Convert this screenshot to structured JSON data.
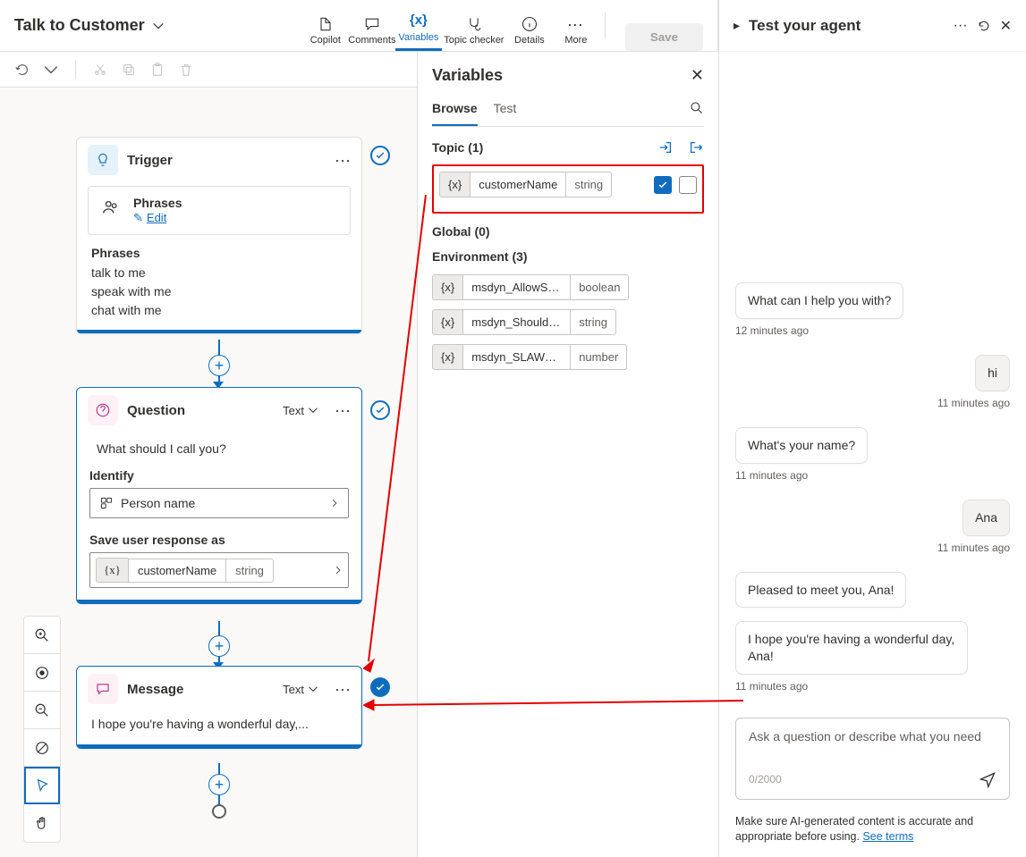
{
  "header": {
    "topic_title": "Talk to Customer",
    "tabs": {
      "copilot": "Copilot",
      "comments": "Comments",
      "variables": "Variables",
      "topic_checker": "Topic checker",
      "details": "Details",
      "more": "More"
    },
    "save_label": "Save"
  },
  "canvas": {
    "trigger": {
      "title": "Trigger",
      "phrases_label": "Phrases",
      "edit": "Edit",
      "subtitle": "Phrases",
      "lines": [
        "talk to me",
        "speak with me",
        "chat with me"
      ]
    },
    "question": {
      "title": "Question",
      "type": "Text",
      "prompt": "What should I call you?",
      "identify_label": "Identify",
      "identify_value": "Person name",
      "save_label": "Save user response as",
      "var_name": "customerName",
      "var_type": "string"
    },
    "message": {
      "title": "Message",
      "type": "Text",
      "text": "I hope you're having a wonderful day,..."
    }
  },
  "variables_panel": {
    "title": "Variables",
    "tabs": {
      "browse": "Browse",
      "test": "Test"
    },
    "topic_header": "Topic (1)",
    "topic_var": {
      "name": "customerName",
      "type": "string",
      "checked": true,
      "checked2": false
    },
    "global_header": "Global (0)",
    "env_header": "Environment (3)",
    "env_vars": [
      {
        "name": "msdyn_AllowSe…",
        "type": "boolean"
      },
      {
        "name": "msdyn_ShouldSho…",
        "type": "string"
      },
      {
        "name": "msdyn_SLAWeb…",
        "type": "number"
      }
    ]
  },
  "test_panel": {
    "title": "Test your agent",
    "messages": [
      {
        "who": "bot",
        "text": "What can I help you with?",
        "ts": "12 minutes ago"
      },
      {
        "who": "user",
        "text": "hi",
        "ts": "11 minutes ago"
      },
      {
        "who": "bot",
        "text": "What's your name?",
        "ts": "11 minutes ago"
      },
      {
        "who": "user",
        "text": "Ana",
        "ts": "11 minutes ago"
      },
      {
        "who": "bot",
        "text": "Pleased to meet you, Ana!",
        "ts": ""
      },
      {
        "who": "bot",
        "text": "I hope you're having a wonderful day, Ana!",
        "ts": "11 minutes ago"
      }
    ],
    "composer_placeholder": "Ask a question or describe what you need",
    "counter": "0/2000",
    "disclaimer_prefix": "Make sure AI-generated content is accurate and appropriate before using. ",
    "disclaimer_link": "See terms"
  }
}
